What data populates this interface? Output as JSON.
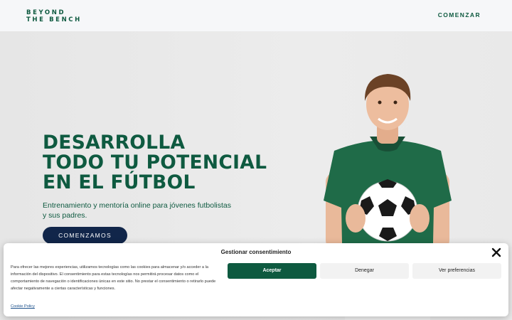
{
  "header": {
    "logo_line1": "BEYOND",
    "logo_line2": "THE BENCH",
    "nav_cta": "COMENZAR"
  },
  "hero": {
    "headline": [
      "DESARROLLA",
      "TODO TU POTENCIAL",
      "EN EL FÚTBOL"
    ],
    "subtitle": [
      "Entrenamiento y mentoría online para jóvenes futbolistas",
      "y sus padres."
    ],
    "cta_label": "COMENZAMOS"
  },
  "consent": {
    "title": "Gestionar consentimiento",
    "body": "Para ofrecer las mejores experiencias, utilizamos tecnologías como las cookies para almacenar y/o acceder a la información del dispositivo. El consentimiento para estas tecnologías nos permitirá procesar datos como el comportamiento de navegación o identificaciones únicas en este sitio. No prestar el consentimiento o retirarlo puede afectar negativamente a ciertas características y funciones.",
    "accept_label": "Aceptar",
    "deny_label": "Denegar",
    "prefs_label": "Ver preferencias",
    "policy_label": "Cookie Policy"
  },
  "colors": {
    "brand_green": "#0e5a40",
    "navy": "#11264a",
    "page_bg": "#e9e9e9"
  }
}
